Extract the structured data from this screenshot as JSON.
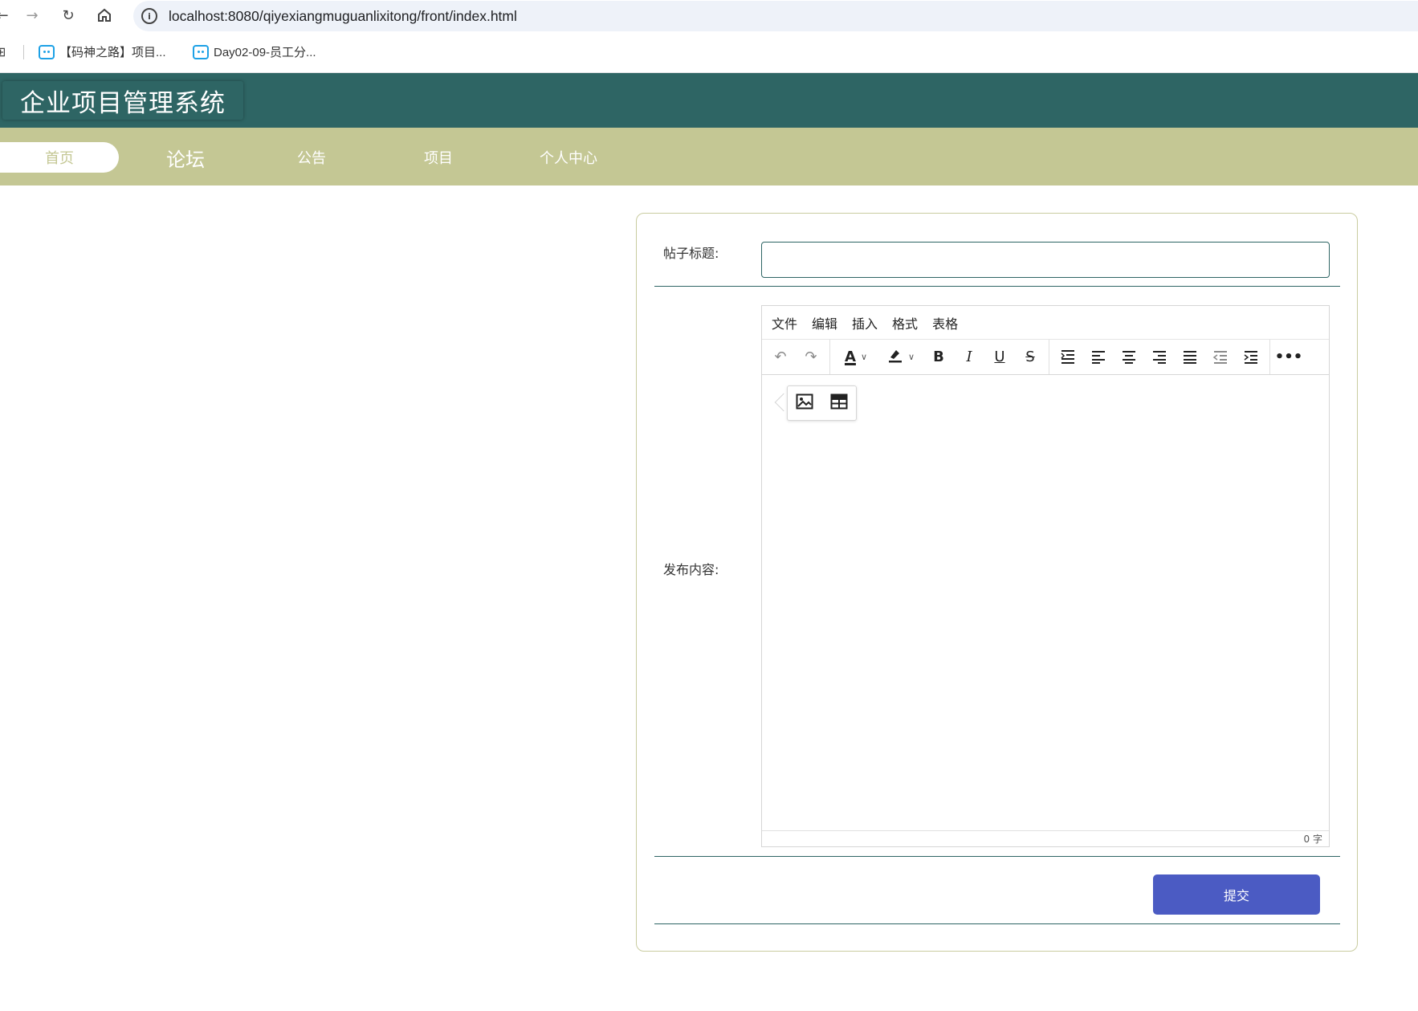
{
  "browser": {
    "url": "localhost:8080/qiyexiangmuguanlixitong/front/index.html",
    "bookmarks": [
      {
        "label": "【码神之路】项目..."
      },
      {
        "label": "Day02-09-员工分..."
      }
    ]
  },
  "app": {
    "title": "企业项目管理系统",
    "nav": [
      {
        "label": "首页"
      },
      {
        "label": "论坛"
      },
      {
        "label": "公告"
      },
      {
        "label": "项目"
      },
      {
        "label": "个人中心"
      }
    ]
  },
  "form": {
    "title_label": "帖子标题:",
    "title_value": "",
    "content_label": "发布内容:",
    "editor": {
      "menu": [
        "文件",
        "编辑",
        "插入",
        "格式",
        "表格"
      ],
      "word_count": "0 字"
    },
    "submit_label": "提交"
  },
  "colors": {
    "header": "#2e6564",
    "nav": "#c4c794",
    "submit": "#4b5bc3"
  }
}
